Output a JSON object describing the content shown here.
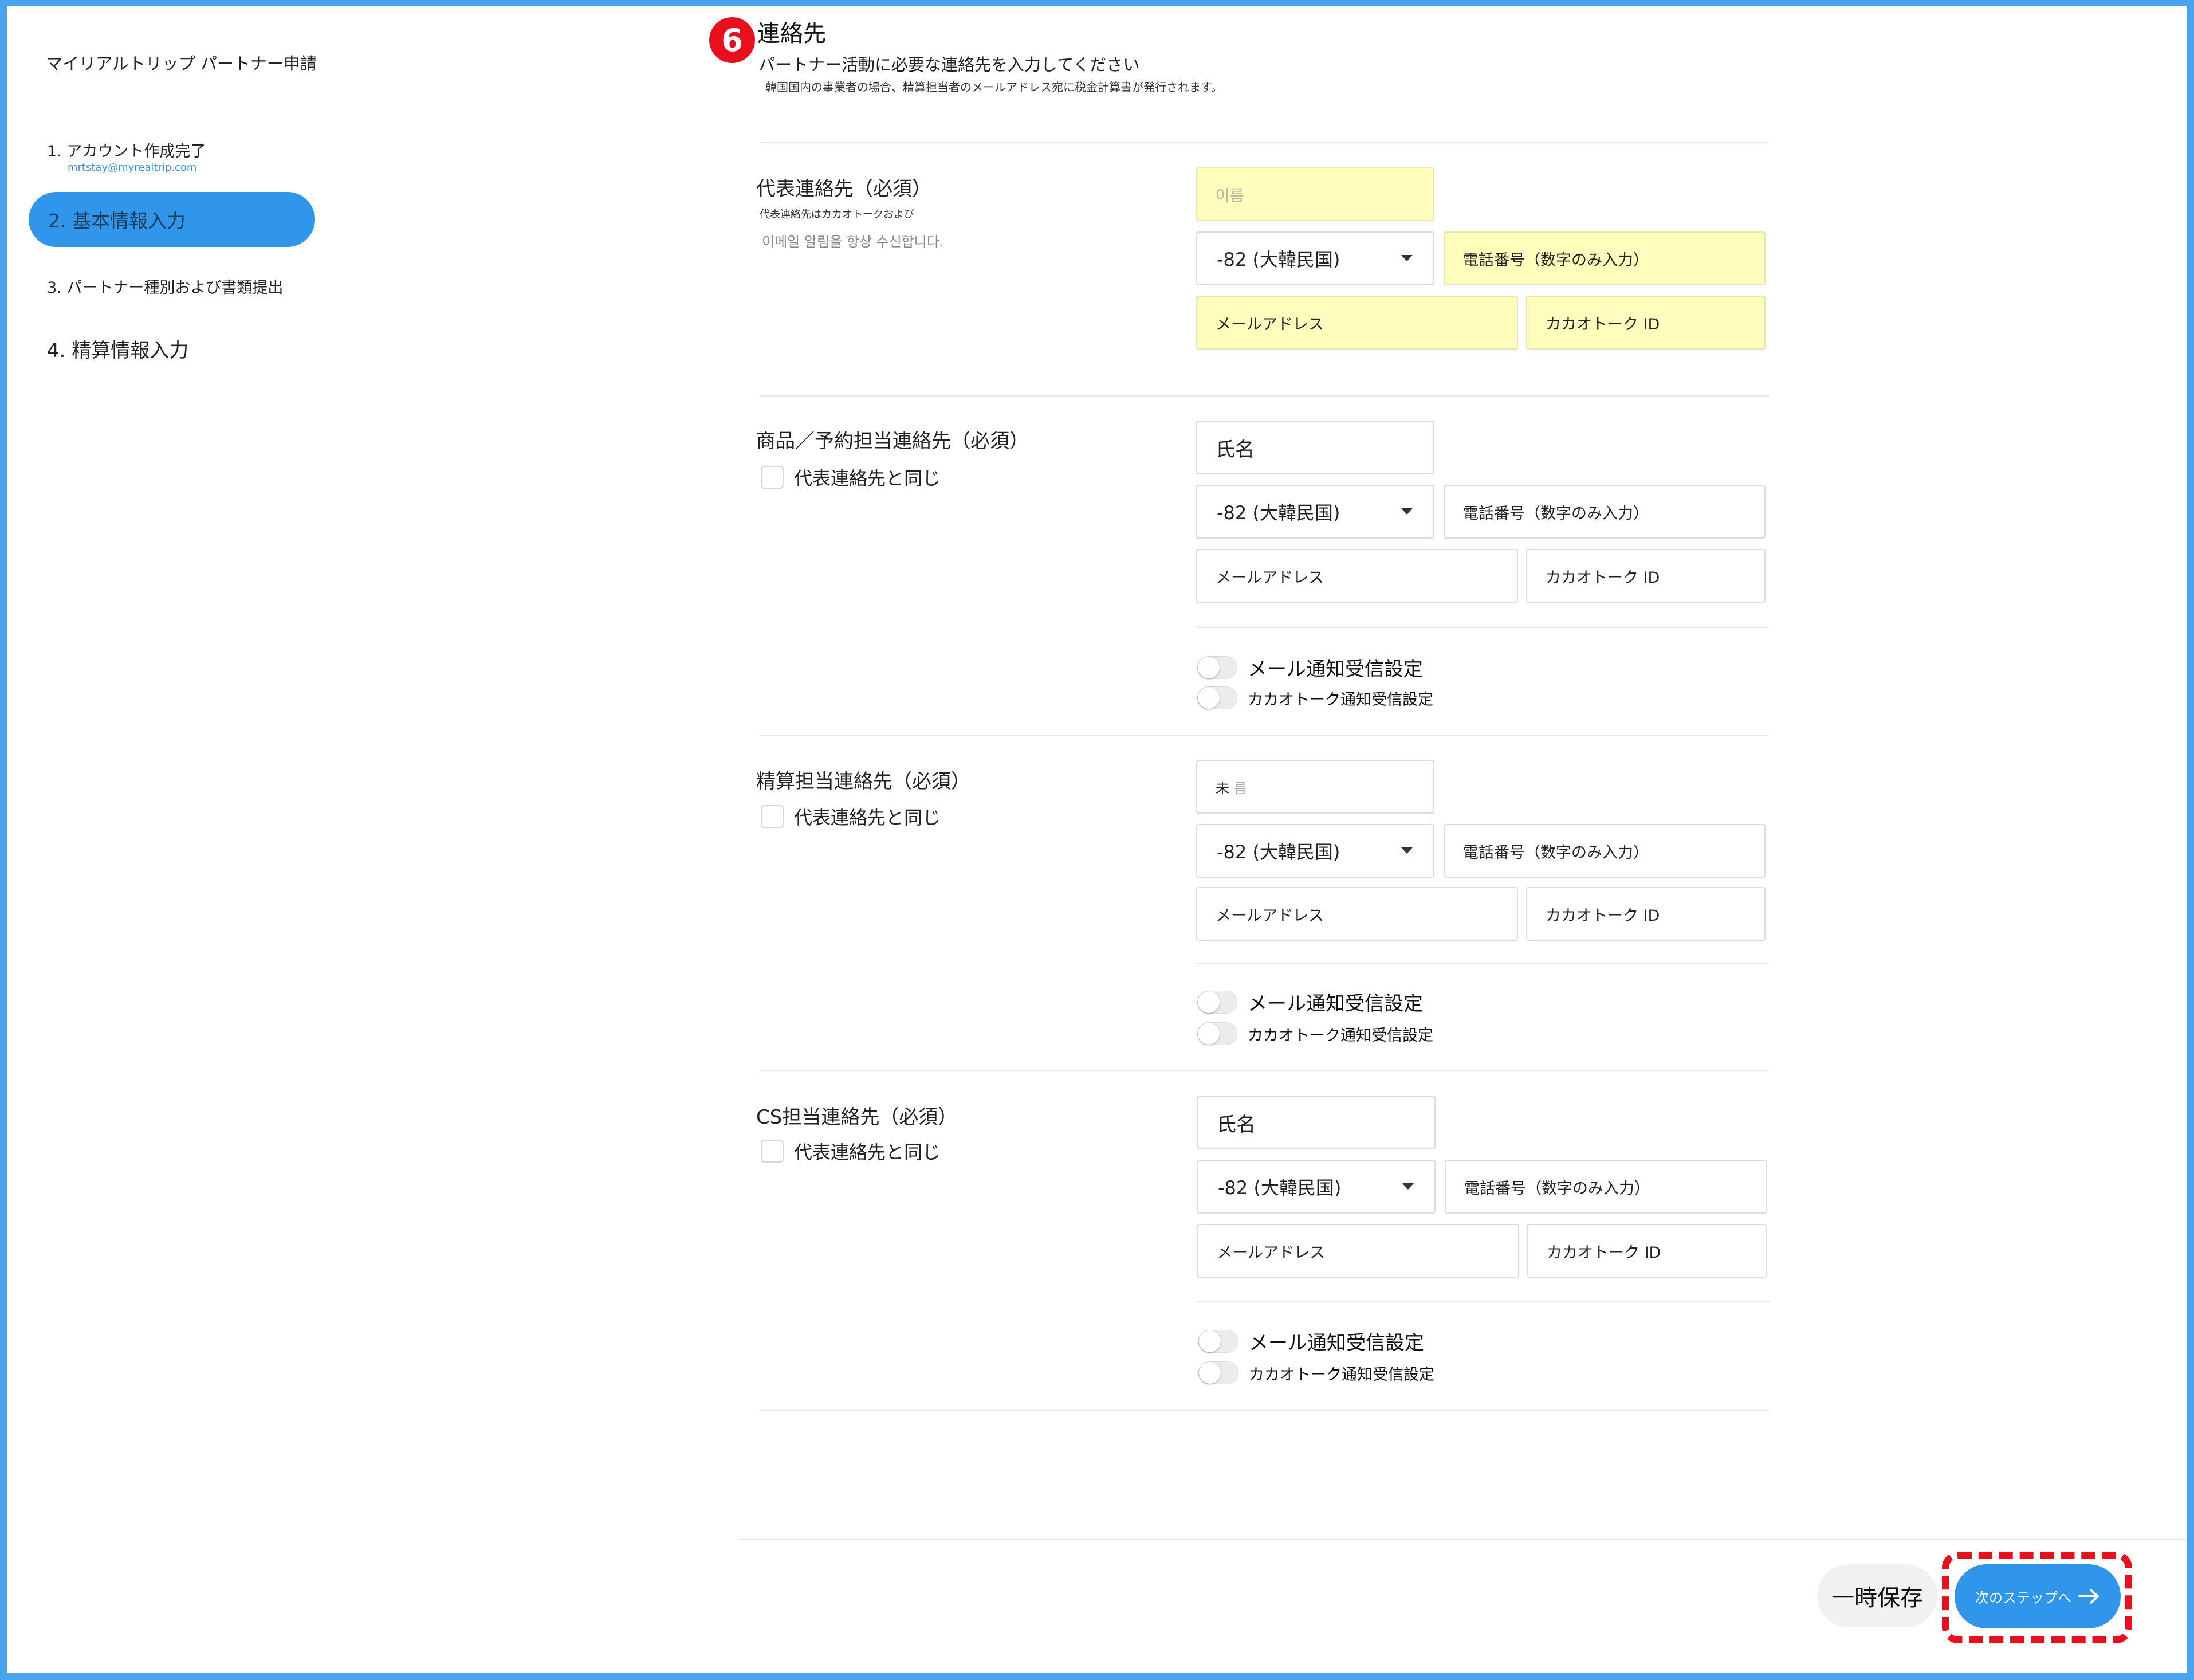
{
  "app": {
    "title": "マイリアルトリップ パートナー申請"
  },
  "steps": [
    {
      "label": "1. アカウント作成完了",
      "sub": "mrtstay@myrealtrip.com"
    },
    {
      "label": "2. 基本情報入力"
    },
    {
      "label": "3. パートナー種別および書類提出"
    },
    {
      "label": "4. 精算情報入力"
    }
  ],
  "section": {
    "badge": "6",
    "title": "連絡先",
    "subtitle": "パートナー活動に必要な連絡先を入力してください",
    "note": "韓国国内の事業者の場合、精算担当者のメールアドレス宛に税金計算書が発行されます。"
  },
  "groups": {
    "main": {
      "label": "代表連絡先（必須）",
      "sub1": "代表連絡先はカカオトークおよび",
      "sub2": "이메일 알림을 항상 수신합니다.",
      "name_placeholder": "이름",
      "country": "-82 (大韓民国)",
      "phone_placeholder": "電話番号（数字のみ入力）",
      "email_placeholder": "メールアドレス",
      "kakao_placeholder": "カカオトーク ID"
    },
    "product": {
      "label": "商品／予約担当連絡先（必須）",
      "same_label": "代表連絡先と同じ",
      "name_value": "氏名",
      "country": "-82 (大韓民国)",
      "phone_placeholder": "電話番号（数字のみ入力）",
      "email_placeholder": "メールアドレス",
      "kakao_placeholder": "カカオトーク ID",
      "email_toggle": "メール通知受信設定",
      "kakao_toggle": "カカオトーク通知受信設定"
    },
    "settlement": {
      "label": "精算担当連絡先（必須）",
      "same_label": "代表連絡先と同じ",
      "name_prefix": "未",
      "name_placeholder": "름",
      "country": "-82 (大韓民国)",
      "phone_placeholder": "電話番号（数字のみ入力）",
      "email_placeholder": "メールアドレス",
      "kakao_placeholder": "カカオトーク ID",
      "email_toggle": "メール通知受信設定",
      "kakao_toggle": "カカオトーク通知受信設定"
    },
    "cs": {
      "label": "CS担当連絡先（必須）",
      "same_label": "代表連絡先と同じ",
      "name_value": "氏名",
      "country": "-82 (大韓民国)",
      "phone_placeholder": "電話番号（数字のみ入力）",
      "email_placeholder": "メールアドレス",
      "kakao_placeholder": "カカオトーク ID",
      "email_toggle": "メール通知受信設定",
      "kakao_toggle": "カカオトーク通知受信設定"
    }
  },
  "footer": {
    "save_label": "一時保存",
    "next_label": "次のステップへ",
    "next_icon": "arrow-right-icon"
  },
  "colors": {
    "accent": "#2f96ec",
    "highlight": "#e8101c",
    "required_field_bg": "#fefdbb"
  }
}
